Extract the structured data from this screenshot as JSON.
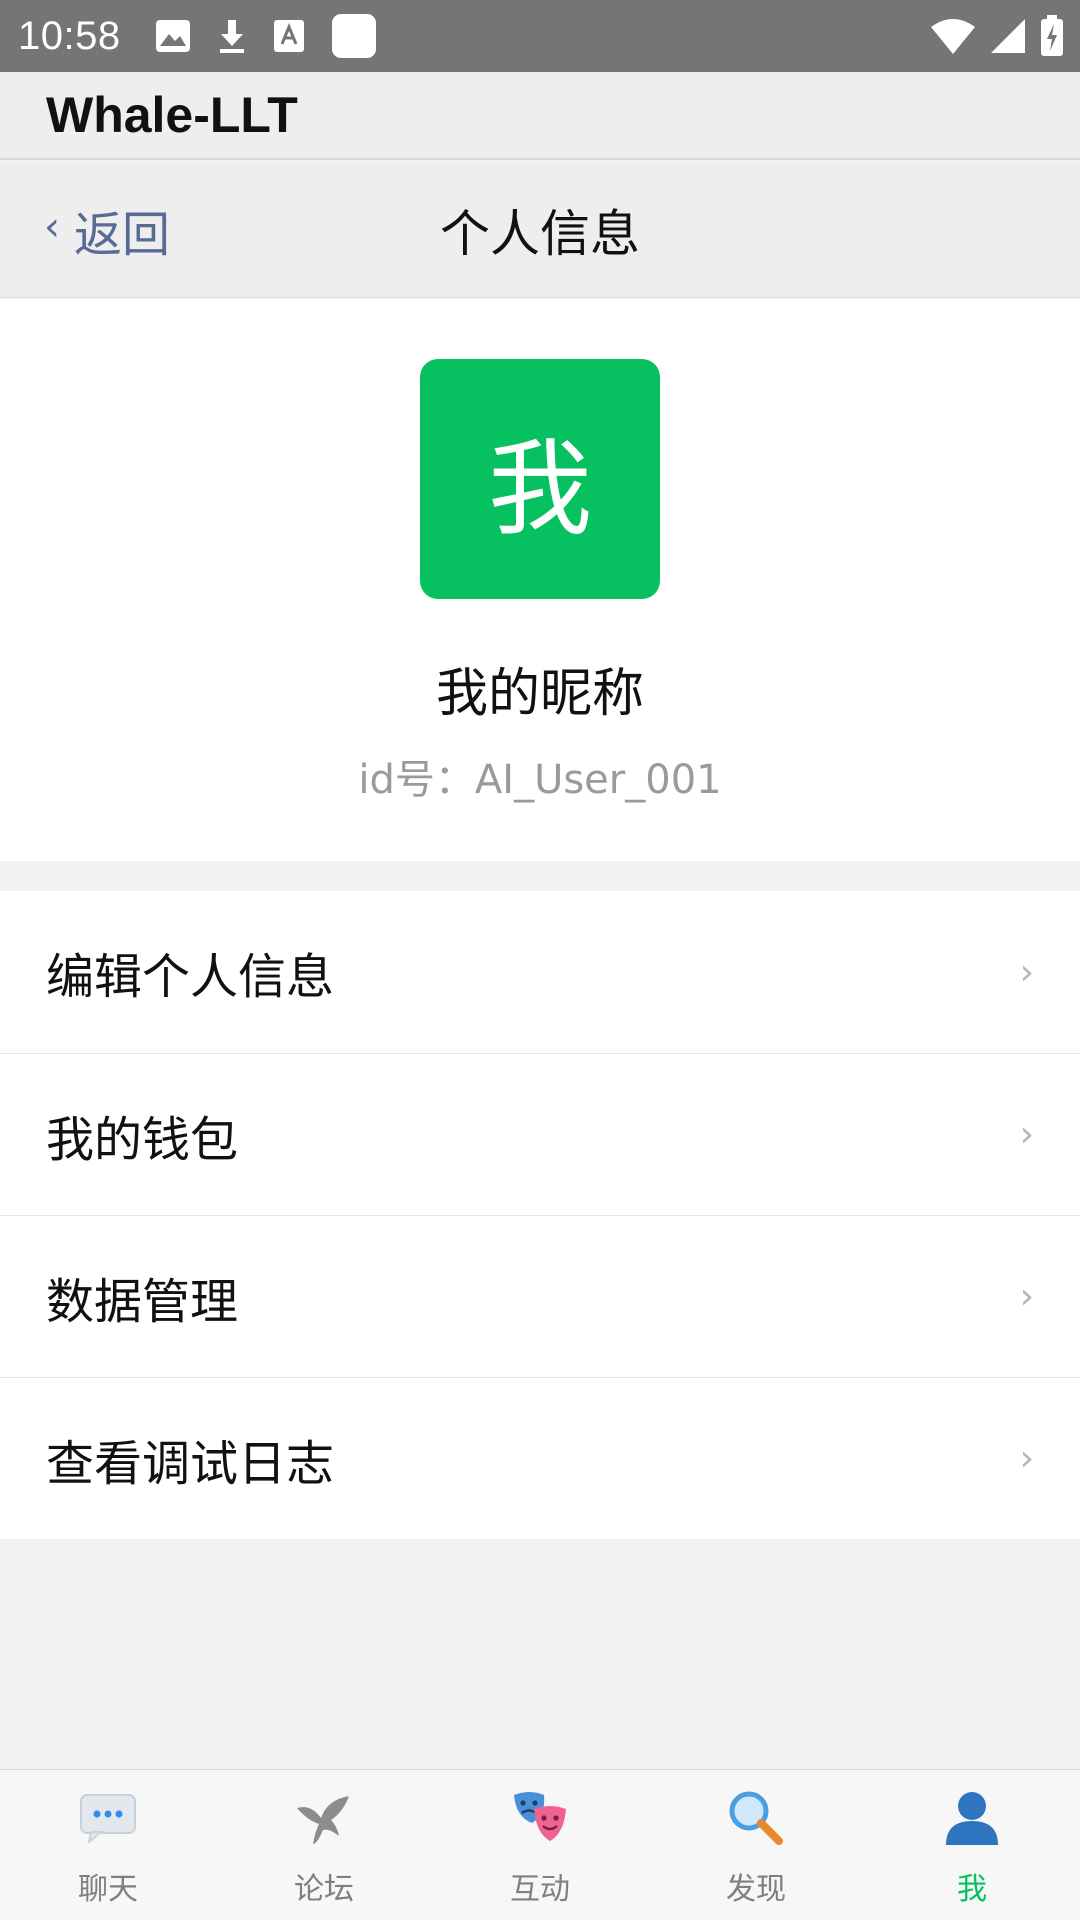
{
  "status_bar": {
    "time": "10:58",
    "left_icons": [
      "image-icon",
      "download-icon",
      "font-download-icon",
      "blank-square-icon"
    ],
    "right_icons": [
      "wifi-icon",
      "cellular-signal-icon",
      "battery-charging-icon"
    ]
  },
  "app_bar": {
    "title": "Whale-LLT"
  },
  "header": {
    "back_label": "返回",
    "back_chevron": "‹",
    "title": "个人信息"
  },
  "profile": {
    "avatar_text": "我",
    "avatar_color": "#07c160",
    "nickname": "我的昵称",
    "id_text": "id号：AI_User_001"
  },
  "menu": {
    "chevron": "›",
    "items": [
      {
        "label": "编辑个人信息"
      },
      {
        "label": "我的钱包"
      },
      {
        "label": "数据管理"
      },
      {
        "label": "查看调试日志"
      }
    ]
  },
  "tabs": [
    {
      "label": "聊天",
      "icon": "chat-bubble-icon",
      "active": false
    },
    {
      "label": "论坛",
      "icon": "forum-bird-icon",
      "active": false
    },
    {
      "label": "互动",
      "icon": "theater-masks-icon",
      "active": false
    },
    {
      "label": "发现",
      "icon": "magnifier-icon",
      "active": false
    },
    {
      "label": "我",
      "icon": "user-icon",
      "active": true
    }
  ],
  "colors": {
    "accent": "#07c160",
    "link": "#576b95",
    "inactive_tab": "#7f7f7f"
  }
}
